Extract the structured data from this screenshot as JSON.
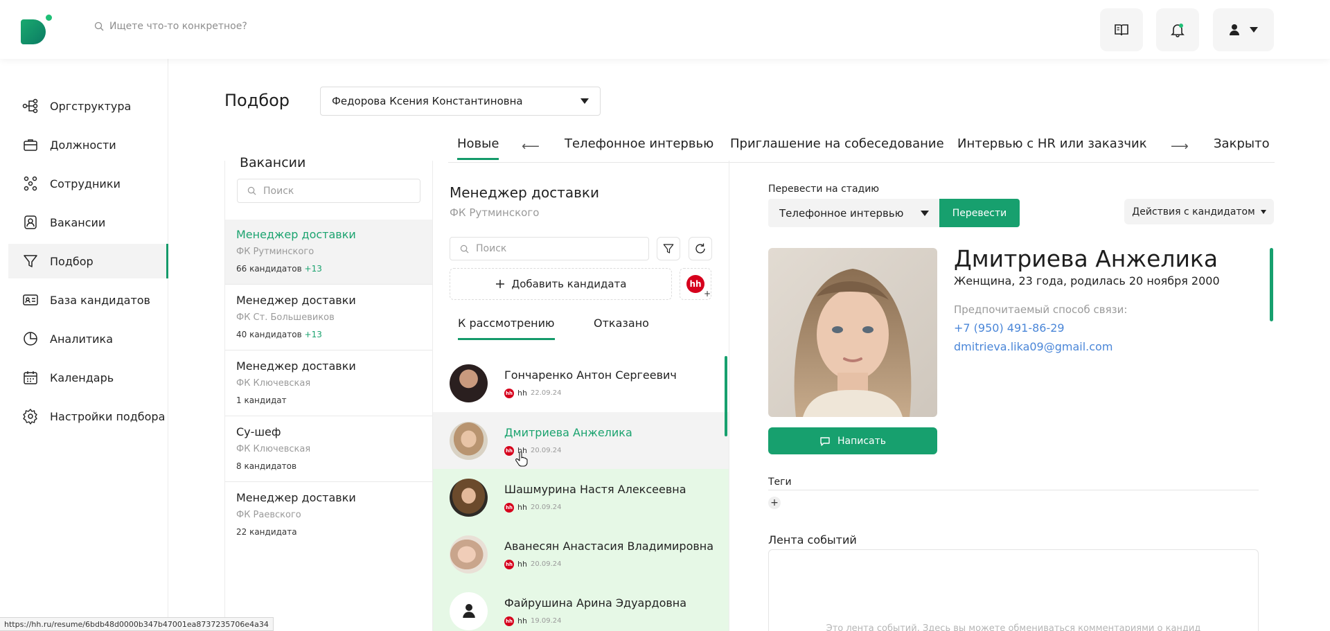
{
  "header": {
    "search_placeholder": "Ищете что-то конкретное?",
    "icons": [
      "book-icon",
      "bell-icon",
      "user-icon"
    ]
  },
  "sidebar": {
    "items": [
      {
        "label": "Оргструктура",
        "icon": "org-structure-icon"
      },
      {
        "label": "Должности",
        "icon": "briefcase-icon"
      },
      {
        "label": "Сотрудники",
        "icon": "employees-icon"
      },
      {
        "label": "Вакансии",
        "icon": "vacancy-icon"
      },
      {
        "label": "Подбор",
        "icon": "funnel-icon",
        "active": true
      },
      {
        "label": "База кандидатов",
        "icon": "id-card-icon"
      },
      {
        "label": "Аналитика",
        "icon": "pie-chart-icon"
      },
      {
        "label": "Календарь",
        "icon": "calendar-icon"
      },
      {
        "label": "Настройки подбора",
        "icon": "gear-icon"
      }
    ]
  },
  "page": {
    "title": "Подбор",
    "recruiter": "Федорова Ксения Константиновна"
  },
  "stages": {
    "items": [
      "Новые",
      "Телефонное интервью",
      "Приглашение на собеседование",
      "Интервью с HR или заказчик",
      "Закрыто"
    ],
    "active": "Новые",
    "arrow_left": "⟵",
    "arrow_right": "⟶"
  },
  "vacancies": {
    "title": "Вакансии",
    "search_placeholder": "Поиск",
    "items": [
      {
        "name": "Менеджер доставки",
        "company": "ФК Рутминского",
        "count": "66 кандидатов",
        "new": "+13",
        "active": true
      },
      {
        "name": "Менеджер доставки",
        "company": "ФК Ст. Большевиков",
        "count": "40 кандидатов",
        "new": "+13"
      },
      {
        "name": "Менеджер доставки",
        "company": "ФК Ключевская",
        "count": "1 кандидат",
        "new": ""
      },
      {
        "name": "Су-шеф",
        "company": "ФК Ключевская",
        "count": "8 кандидатов",
        "new": ""
      },
      {
        "name": "Менеджер доставки",
        "company": "ФК Раевского",
        "count": "22 кандидата",
        "new": ""
      }
    ]
  },
  "candidates": {
    "vacancy_title": "Менеджер доставки",
    "vacancy_company": "ФК Рутминского",
    "search_placeholder": "Поиск",
    "add_label": "Добавить кандидата",
    "hh_label": "hh",
    "tabs": [
      "К рассмотрению",
      "Отказано"
    ],
    "active_tab": "К рассмотрению",
    "items": [
      {
        "name": "Гончаренко Антон Сергеевич",
        "source": "hh",
        "date": "22.09.24",
        "state": "normal"
      },
      {
        "name": "Дмитриева Анжелика",
        "source": "hh",
        "date": "20.09.24",
        "state": "selected"
      },
      {
        "name": "Шашмурина Настя Алексеевна",
        "source": "hh",
        "date": "20.09.24",
        "state": "new"
      },
      {
        "name": "Аванесян Анастасия Владимировна",
        "source": "hh",
        "date": "20.09.24",
        "state": "new"
      },
      {
        "name": "Файрушина Арина Эдуардовна",
        "source": "hh",
        "date": "19.09.24",
        "state": "new"
      }
    ]
  },
  "detail": {
    "stage_label": "Перевести на стадию",
    "stage_value": "Телефонное интервью",
    "move_label": "Перевести",
    "actions_label": "Действия с кандидатом",
    "name": "Дмитриева Анжелика",
    "bio": "Женщина, 23 года, родилась 20 ноября 2000",
    "contact_label": "Предпочитаемый способ связи:",
    "phone": "+7 (950) 491-86-29",
    "email": "dmitrieva.lika09@gmail.com",
    "write_label": "Написать",
    "tags_label": "Теги",
    "tag_add": "+",
    "feed_label": "Лента событий",
    "feed_text": "Это лента событий. Здесь вы можете обмениваться комментариями о кандид"
  },
  "status_url": "https://hh.ru/resume/6bdb48d0000b347b47001ea8737235706e4a34",
  "colors": {
    "accent": "#17a06e",
    "link": "#4a86d8",
    "hh": "#d6001c",
    "new_row": "#e6f8e6"
  }
}
